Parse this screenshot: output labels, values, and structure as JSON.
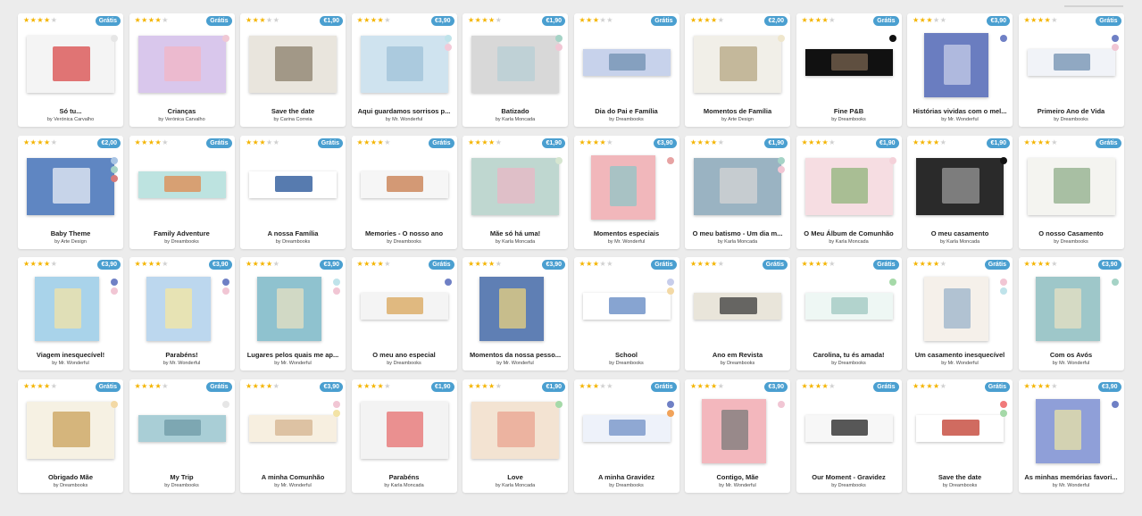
{
  "products": [
    {
      "title": "Só tu...",
      "author": "by Verónica Carvalho",
      "rating": 4,
      "price": "Grátis",
      "colors": [
        "#e6e6e6"
      ],
      "shape": "land",
      "bg": "#f4f4f4",
      "accent": "#d94a4a"
    },
    {
      "title": "Crianças",
      "author": "by Verónica Carvalho",
      "rating": 4,
      "price": "Grátis",
      "colors": [
        "#f0c8d4"
      ],
      "shape": "land",
      "bg": "#d9c7ec",
      "accent": "#f2b6c6"
    },
    {
      "title": "Save the date",
      "author": "by Carina Correia",
      "rating": 3,
      "price": "€1,90",
      "colors": [],
      "shape": "land",
      "bg": "#e9e5dd",
      "accent": "#8a7d6a"
    },
    {
      "title": "Aqui guardamos sorrisos p...",
      "author": "by Mr. Wonderful",
      "rating": 4,
      "price": "€3,90",
      "colors": [
        "#bfe3ea",
        "#f3c9d8"
      ],
      "shape": "land",
      "bg": "#cfe3ef",
      "accent": "#9fc2d8"
    },
    {
      "title": "Batizado",
      "author": "by Karla Moncada",
      "rating": 4,
      "price": "€1,90",
      "colors": [
        "#a5d3c6",
        "#f1c6d4"
      ],
      "shape": "land",
      "bg": "#d8d8d8",
      "accent": "#b7cfd6"
    },
    {
      "title": "Dia do Pai e Família",
      "author": "by Dreambooks",
      "rating": 3,
      "price": "Grátis",
      "colors": [],
      "shape": "pano",
      "bg": "#c7d2eb",
      "accent": "#6f8fb0"
    },
    {
      "title": "Momentos de Família",
      "author": "by Arte Design",
      "rating": 4,
      "price": "€2,00",
      "colors": [
        "#efe6cc"
      ],
      "shape": "land",
      "bg": "#f1efe8",
      "accent": "#b4a582"
    },
    {
      "title": "Fine P&B",
      "author": "by Dreambooks",
      "rating": 4,
      "price": "Grátis",
      "colors": [
        "#111111"
      ],
      "shape": "pano",
      "bg": "#111111",
      "accent": "#7a6450"
    },
    {
      "title": "Histórias vividas com o mel...",
      "author": "by Mr. Wonderful",
      "rating": 3,
      "price": "€3,90",
      "colors": [
        "#6f80c5"
      ],
      "shape": "sq",
      "bg": "#6a7dc0",
      "accent": "#c7cde8"
    },
    {
      "title": "Primeiro Ano de Vida",
      "author": "by Dreambooks",
      "rating": 4,
      "price": "Grátis",
      "colors": [
        "#6f80c5",
        "#f1c6d4"
      ],
      "shape": "pano",
      "bg": "#f1f3f8",
      "accent": "#6f8fb0"
    },
    {
      "title": "Baby Theme",
      "author": "by Arte Design",
      "rating": 4,
      "price": "€2,00",
      "colors": [
        "#a8c4e4",
        "#a5d3c6",
        "#d77a7a"
      ],
      "shape": "land",
      "bg": "#5f86c2",
      "accent": "#e9eef5"
    },
    {
      "title": "Family Adventure",
      "author": "by Dreambooks",
      "rating": 4,
      "price": "Grátis",
      "colors": [],
      "shape": "pano",
      "bg": "#bde3e0",
      "accent": "#e08a4f"
    },
    {
      "title": "A nossa Família",
      "author": "by Dreambooks",
      "rating": 3,
      "price": "Grátis",
      "colors": [],
      "shape": "pano",
      "bg": "#ffffff",
      "accent": "#1f4f94"
    },
    {
      "title": "Memories - O nosso ano",
      "author": "by Dreambooks",
      "rating": 4,
      "price": "Grátis",
      "colors": [],
      "shape": "pano",
      "bg": "#f6f6f6",
      "accent": "#c77a4a"
    },
    {
      "title": "Mãe só há uma!",
      "author": "by Karla Moncada",
      "rating": 4,
      "price": "€1,90",
      "colors": [
        "#d6e6d0"
      ],
      "shape": "land",
      "bg": "#bfd7d0",
      "accent": "#e9b7c6"
    },
    {
      "title": "Momentos especiais",
      "author": "by Mr. Wonderful",
      "rating": 4,
      "price": "€3,90",
      "colors": [
        "#e7a3a3"
      ],
      "shape": "sq",
      "bg": "#f1b7bb",
      "accent": "#8fc5c7"
    },
    {
      "title": "O meu batismo - Um dia m...",
      "author": "by Karla Moncada",
      "rating": 4,
      "price": "€1,90",
      "colors": [
        "#a5d3c6",
        "#f1c6d4"
      ],
      "shape": "land",
      "bg": "#9ab3c2",
      "accent": "#d4d4d4"
    },
    {
      "title": "O Meu Álbum de Comunhão",
      "author": "by Karla Moncada",
      "rating": 4,
      "price": "€1,90",
      "colors": [
        "#f4d1d9"
      ],
      "shape": "land",
      "bg": "#f6dde2",
      "accent": "#8fb37a"
    },
    {
      "title": "O meu casamento",
      "author": "by Karla Moncada",
      "rating": 4,
      "price": "€1,90",
      "colors": [
        "#111111"
      ],
      "shape": "land",
      "bg": "#2a2a2a",
      "accent": "#9a9a9a"
    },
    {
      "title": "O nosso Casamento",
      "author": "by Dreambooks",
      "rating": 4,
      "price": "Grátis",
      "colors": [],
      "shape": "land",
      "bg": "#f4f4f0",
      "accent": "#8fae8a"
    },
    {
      "title": "Viagem inesquecível!",
      "author": "by Mr. Wonderful",
      "rating": 4,
      "price": "€3,90",
      "colors": [
        "#6f80c5",
        "#f1c6d4"
      ],
      "shape": "sq",
      "bg": "#a9d3ea",
      "accent": "#f3e3a5"
    },
    {
      "title": "Parabéns!",
      "author": "by Mr. Wonderful",
      "rating": 4,
      "price": "€3,90",
      "colors": [
        "#6f80c5",
        "#f1c6d4"
      ],
      "shape": "sq",
      "bg": "#bcd7ee",
      "accent": "#f6e7a0"
    },
    {
      "title": "Lugares pelos quais me ap...",
      "author": "by Mr. Wonderful",
      "rating": 4,
      "price": "€3,90",
      "colors": [
        "#bfe3ea",
        "#f1c6d4"
      ],
      "shape": "sq",
      "bg": "#8fc2cf",
      "accent": "#e7e0c2"
    },
    {
      "title": "O meu ano especial",
      "author": "by Dreambooks",
      "rating": 4,
      "price": "Grátis",
      "colors": [
        "#6f80c5"
      ],
      "shape": "pano",
      "bg": "#f4f4f4",
      "accent": "#d9a65a"
    },
    {
      "title": "Momentos da nossa pesso...",
      "author": "by Mr. Wonderful",
      "rating": 4,
      "price": "€3,90",
      "colors": [],
      "shape": "sq",
      "bg": "#5f7fb4",
      "accent": "#e9d27f"
    },
    {
      "title": "School",
      "author": "by Dreambooks",
      "rating": 3,
      "price": "Grátis",
      "colors": [
        "#c7cdeb",
        "#f3d9a5"
      ],
      "shape": "pano",
      "bg": "#ffffff",
      "accent": "#5f86c2"
    },
    {
      "title": "Ano em Revista",
      "author": "by Dreambooks",
      "rating": 4,
      "price": "Grátis",
      "colors": [],
      "shape": "pano",
      "bg": "#e9e5da",
      "accent": "#3a3a3a"
    },
    {
      "title": "Carolina, tu és amada!",
      "author": "by Dreambooks",
      "rating": 4,
      "price": "Grátis",
      "colors": [
        "#a5d9a8"
      ],
      "shape": "pano",
      "bg": "#eef7f4",
      "accent": "#9ec7c0"
    },
    {
      "title": "Um casamento inesquecível",
      "author": "by Mr. Wonderful",
      "rating": 4,
      "price": "Grátis",
      "colors": [
        "#f1c6d4",
        "#bfe3ea"
      ],
      "shape": "sq",
      "bg": "#f5f0ea",
      "accent": "#9ab3c9"
    },
    {
      "title": "Com os Avós",
      "author": "by Mr. Wonderful",
      "rating": 4,
      "price": "€3,90",
      "colors": [
        "#a5d3c6"
      ],
      "shape": "sq",
      "bg": "#9ec7c9",
      "accent": "#e7e0c2"
    },
    {
      "title": "Obrigado Mãe",
      "author": "by Dreambooks",
      "rating": 4,
      "price": "Grátis",
      "colors": [
        "#f3d9a5"
      ],
      "shape": "land",
      "bg": "#f6f1e3",
      "accent": "#c9a05a"
    },
    {
      "title": "My Trip",
      "author": "by Dreambooks",
      "rating": 4,
      "price": "Grátis",
      "colors": [
        "#e6e6e6"
      ],
      "shape": "pano",
      "bg": "#a9ced6",
      "accent": "#6f9aa6"
    },
    {
      "title": "A minha Comunhão",
      "author": "by Mr. Wonderful",
      "rating": 4,
      "price": "€3,90",
      "colors": [
        "#f1c6d4",
        "#f3e3a5"
      ],
      "shape": "pano",
      "bg": "#f7efe0",
      "accent": "#d4b38f"
    },
    {
      "title": "Parabéns",
      "author": "by Karla Moncada",
      "rating": 4,
      "price": "€1,90",
      "colors": [],
      "shape": "land",
      "bg": "#f3f3f3",
      "accent": "#e76f6f"
    },
    {
      "title": "Love",
      "author": "by Karla Moncada",
      "rating": 4,
      "price": "€1,90",
      "colors": [
        "#a5d9a8"
      ],
      "shape": "land",
      "bg": "#f3e3d2",
      "accent": "#e9a38f"
    },
    {
      "title": "A minha Gravidez",
      "author": "by Dreambooks",
      "rating": 3,
      "price": "Grátis",
      "colors": [
        "#6f80c5",
        "#f1a35a"
      ],
      "shape": "pano",
      "bg": "#eef2fa",
      "accent": "#6f8fc5"
    },
    {
      "title": "Contigo, Mãe",
      "author": "by Mr. Wonderful",
      "rating": 4,
      "price": "€3,90",
      "colors": [
        "#f1c6d4"
      ],
      "shape": "sq",
      "bg": "#f3b7bd",
      "accent": "#7a7a7a"
    },
    {
      "title": "Our Moment - Gravidez",
      "author": "by Dreambooks",
      "rating": 4,
      "price": "Grátis",
      "colors": [],
      "shape": "pano",
      "bg": "#f7f7f7",
      "accent": "#222222"
    },
    {
      "title": "Save the date",
      "author": "by Dreambooks",
      "rating": 4,
      "price": "Grátis",
      "colors": [
        "#f07a7a",
        "#a5d9a8"
      ],
      "shape": "pano",
      "bg": "#ffffff",
      "accent": "#c0392b"
    },
    {
      "title": "As minhas memórias favori...",
      "author": "by Mr. Wonderful",
      "rating": 4,
      "price": "€3,90",
      "colors": [
        "#6f80c5"
      ],
      "shape": "sq",
      "bg": "#8f9fd8",
      "accent": "#e9e3a5"
    }
  ]
}
